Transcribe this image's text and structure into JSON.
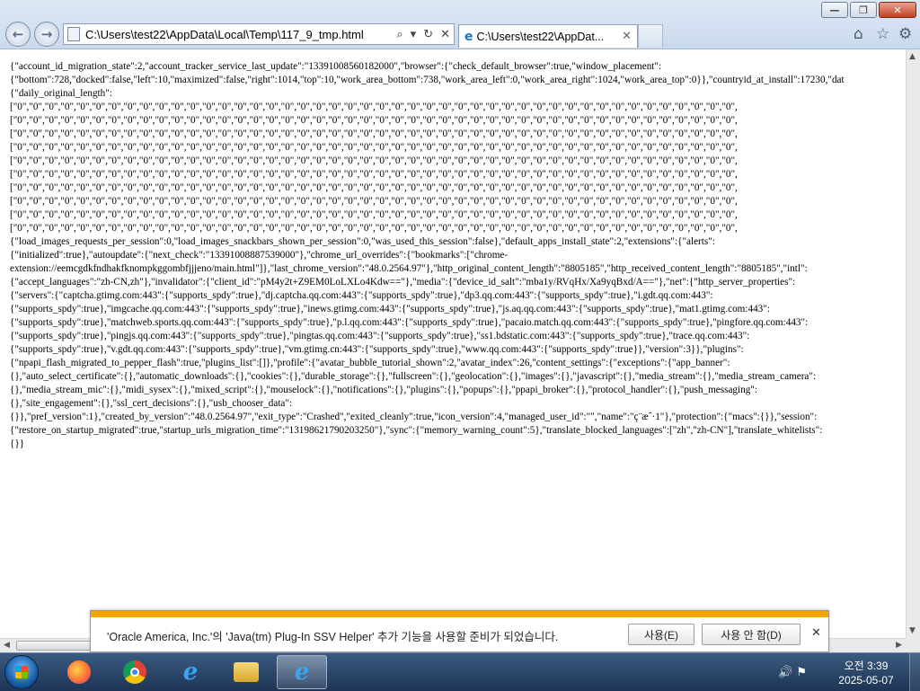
{
  "window": {
    "caption_minimize": "—",
    "caption_restore": "❐",
    "caption_close": "✕"
  },
  "nav": {
    "address": "C:\\Users\\test22\\AppData\\Local\\Temp\\117_9_tmp.html",
    "tab_title": "C:\\Users\\test22\\AppDat...",
    "back_glyph": "←",
    "forward_glyph": "→",
    "search_glyph": "⌕",
    "dropdown_glyph": "▾",
    "refresh_glyph": "↻",
    "stop_glyph": "✕",
    "home_glyph": "⌂",
    "favorites_glyph": "☆",
    "tools_glyph": "⚙",
    "ie_glyph": "e",
    "tab_close_glyph": "✕"
  },
  "document": {
    "lines": [
      "{\"account_id_migration_state\":2,\"account_tracker_service_last_update\":\"13391008560182000\",\"browser\":{\"check_default_browser\":true,\"window_placement\":",
      "{\"bottom\":728,\"docked\":false,\"left\":10,\"maximized\":false,\"right\":1014,\"top\":10,\"work_area_bottom\":738,\"work_area_left\":0,\"work_area_right\":1024,\"work_area_top\":0}},\"countryid_at_install\":17230,\"dat",
      "{\"daily_original_length\":",
      "[\"0\",\"0\",\"0\",\"0\",\"0\",\"0\",\"0\",\"0\",\"0\",\"0\",\"0\",\"0\",\"0\",\"0\",\"0\",\"0\",\"0\",\"0\",\"0\",\"0\",\"0\",\"0\",\"0\",\"0\",\"0\",\"0\",\"0\",\"0\",\"0\",\"0\",\"0\",\"0\",\"0\",\"0\",\"0\",\"0\",\"0\",\"0\",\"0\",\"0\",\"0\",\"0\",\"0\",\"0\",\"0\",\"0\",",
      "[\"0\",\"0\",\"0\",\"0\",\"0\",\"0\",\"0\",\"0\",\"0\",\"0\",\"0\",\"0\",\"0\",\"0\",\"0\",\"0\",\"0\",\"0\",\"0\",\"0\",\"0\",\"0\",\"0\",\"0\",\"0\",\"0\",\"0\",\"0\",\"0\",\"0\",\"0\",\"0\",\"0\",\"0\",\"0\",\"0\",\"0\",\"0\",\"0\",\"0\",\"0\",\"0\",\"0\",\"0\",\"0\",\"0\",",
      "[\"0\",\"0\",\"0\",\"0\",\"0\",\"0\",\"0\",\"0\",\"0\",\"0\",\"0\",\"0\",\"0\",\"0\",\"0\",\"0\",\"0\",\"0\",\"0\",\"0\",\"0\",\"0\",\"0\",\"0\",\"0\",\"0\",\"0\",\"0\",\"0\",\"0\",\"0\",\"0\",\"0\",\"0\",\"0\",\"0\",\"0\",\"0\",\"0\",\"0\",\"0\",\"0\",\"0\",\"0\",\"0\",\"0\",",
      "[\"0\",\"0\",\"0\",\"0\",\"0\",\"0\",\"0\",\"0\",\"0\",\"0\",\"0\",\"0\",\"0\",\"0\",\"0\",\"0\",\"0\",\"0\",\"0\",\"0\",\"0\",\"0\",\"0\",\"0\",\"0\",\"0\",\"0\",\"0\",\"0\",\"0\",\"0\",\"0\",\"0\",\"0\",\"0\",\"0\",\"0\",\"0\",\"0\",\"0\",\"0\",\"0\",\"0\",\"0\",\"0\",\"0\",",
      "[\"0\",\"0\",\"0\",\"0\",\"0\",\"0\",\"0\",\"0\",\"0\",\"0\",\"0\",\"0\",\"0\",\"0\",\"0\",\"0\",\"0\",\"0\",\"0\",\"0\",\"0\",\"0\",\"0\",\"0\",\"0\",\"0\",\"0\",\"0\",\"0\",\"0\",\"0\",\"0\",\"0\",\"0\",\"0\",\"0\",\"0\",\"0\",\"0\",\"0\",\"0\",\"0\",\"0\",\"0\",\"0\",\"0\",",
      "[\"0\",\"0\",\"0\",\"0\",\"0\",\"0\",\"0\",\"0\",\"0\",\"0\",\"0\",\"0\",\"0\",\"0\",\"0\",\"0\",\"0\",\"0\",\"0\",\"0\",\"0\",\"0\",\"0\",\"0\",\"0\",\"0\",\"0\",\"0\",\"0\",\"0\",\"0\",\"0\",\"0\",\"0\",\"0\",\"0\",\"0\",\"0\",\"0\",\"0\",\"0\",\"0\",\"0\",\"0\",\"0\",\"0\",",
      "[\"0\",\"0\",\"0\",\"0\",\"0\",\"0\",\"0\",\"0\",\"0\",\"0\",\"0\",\"0\",\"0\",\"0\",\"0\",\"0\",\"0\",\"0\",\"0\",\"0\",\"0\",\"0\",\"0\",\"0\",\"0\",\"0\",\"0\",\"0\",\"0\",\"0\",\"0\",\"0\",\"0\",\"0\",\"0\",\"0\",\"0\",\"0\",\"0\",\"0\",\"0\",\"0\",\"0\",\"0\",\"0\",\"0\",",
      "[\"0\",\"0\",\"0\",\"0\",\"0\",\"0\",\"0\",\"0\",\"0\",\"0\",\"0\",\"0\",\"0\",\"0\",\"0\",\"0\",\"0\",\"0\",\"0\",\"0\",\"0\",\"0\",\"0\",\"0\",\"0\",\"0\",\"0\",\"0\",\"0\",\"0\",\"0\",\"0\",\"0\",\"0\",\"0\",\"0\",\"0\",\"0\",\"0\",\"0\",\"0\",\"0\",\"0\",\"0\",\"0\",\"0\",",
      "[\"0\",\"0\",\"0\",\"0\",\"0\",\"0\",\"0\",\"0\",\"0\",\"0\",\"0\",\"0\",\"0\",\"0\",\"0\",\"0\",\"0\",\"0\",\"0\",\"0\",\"0\",\"0\",\"0\",\"0\",\"0\",\"0\",\"0\",\"0\",\"0\",\"0\",\"0\",\"0\",\"0\",\"0\",\"0\",\"0\",\"0\",\"0\",\"0\",\"0\",\"0\",\"0\",\"0\",\"0\",\"0\",\"0\",",
      "[\"0\",\"0\",\"0\",\"0\",\"0\",\"0\",\"0\",\"0\",\"0\",\"0\",\"0\",\"0\",\"0\",\"0\",\"0\",\"0\",\"0\",\"0\",\"0\",\"0\",\"0\",\"0\",\"0\",\"0\",\"0\",\"0\",\"0\",\"0\",\"0\",\"0\",\"0\",\"0\",\"0\",\"0\",\"0\",\"0\",\"0\",\"0\",\"0\",\"0\",\"0\",\"0\",\"0\",\"0\",\"0\",\"0\",",
      "{\"load_images_requests_per_session\":0,\"load_images_snackbars_shown_per_session\":0,\"was_used_this_session\":false},\"default_apps_install_state\":2,\"extensions\":{\"alerts\":",
      "{\"initialized\":true},\"autoupdate\":{\"next_check\":\"13391008887539000\"},\"chrome_url_overrides\":{\"bookmarks\":[\"chrome-",
      "extension://eemcgdkfndhakfknompkggombfjjjeno/main.html\"]},\"last_chrome_version\":\"48.0.2564.97\"},\"http_original_content_length\":\"8805185\",\"http_received_content_length\":\"8805185\",\"intl\":",
      "{\"accept_languages\":\"zh-CN,zh\"},\"invalidator\":{\"client_id\":\"pM4y2t+Z9EM0LoLXLo4Kdw==\"},\"media\":{\"device_id_salt\":\"mba1y/RVqHx/Xa9yqBxd/A==\"},\"net\":{\"http_server_properties\":",
      "{\"servers\":{\"captcha.gtimg.com:443\":{\"supports_spdy\":true},\"dj.captcha.qq.com:443\":{\"supports_spdy\":true},\"dp3.qq.com:443\":{\"supports_spdy\":true},\"i.gdt.qq.com:443\":",
      "{\"supports_spdy\":true},\"imgcache.qq.com:443\":{\"supports_spdy\":true},\"inews.gtimg.com:443\":{\"supports_spdy\":true},\"js.aq.qq.com:443\":{\"supports_spdy\":true},\"mat1.gtimg.com:443\":",
      "{\"supports_spdy\":true},\"matchweb.sports.qq.com:443\":{\"supports_spdy\":true},\"p.l.qq.com:443\":{\"supports_spdy\":true},\"pacaio.match.qq.com:443\":{\"supports_spdy\":true},\"pingfore.qq.com:443\":",
      "{\"supports_spdy\":true},\"pingjs.qq.com:443\":{\"supports_spdy\":true},\"pingtas.qq.com:443\":{\"supports_spdy\":true},\"ss1.bdstatic.com:443\":{\"supports_spdy\":true},\"trace.qq.com:443\":",
      "{\"supports_spdy\":true},\"v.gdt.qq.com:443\":{\"supports_spdy\":true},\"vm.gtimg.cn:443\":{\"supports_spdy\":true},\"www.qq.com:443\":{\"supports_spdy\":true}},\"version\":3}},\"plugins\":",
      "{\"npapi_flash_migrated_to_pepper_flash\":true,\"plugins_list\":[]},\"profile\":{\"avatar_bubble_tutorial_shown\":2,\"avatar_index\":26,\"content_settings\":{\"exceptions\":{\"app_banner\":",
      "{},\"auto_select_certificate\":{},\"automatic_downloads\":{},\"cookies\":{},\"durable_storage\":{},\"fullscreen\":{},\"geolocation\":{},\"images\":{},\"javascript\":{},\"media_stream\":{},\"media_stream_camera\":",
      "{},\"media_stream_mic\":{},\"midi_sysex\":{},\"mixed_script\":{},\"mouselock\":{},\"notifications\":{},\"plugins\":{},\"popups\":{},\"ppapi_broker\":{},\"protocol_handler\":{},\"push_messaging\":",
      "{},\"site_engagement\":{},\"ssl_cert_decisions\":{},\"usb_chooser_data\":",
      "{}},\"pref_version\":1},\"created_by_version\":\"48.0.2564.97\",\"exit_type\":\"Crashed\",\"exited_cleanly\":true,\"icon_version\":4,\"managed_user_id\":\"\",\"name\":\"ç¨æˆ·1\"},\"protection\":{\"macs\":{}},\"session\":",
      "{\"restore_on_startup_migrated\":true,\"startup_urls_migration_time\":\"13198621790203250\"},\"sync\":{\"memory_warning_count\":5},\"translate_blocked_languages\":[\"zh\",\"zh-CN\"],\"translate_whitelists\":",
      "{}}"
    ]
  },
  "notification": {
    "message": "'Oracle America, Inc.'의 'Java(tm) Plug-In SSV Helper' 추가 기능을 사용할 준비가 되었습니다.",
    "allow_label": "사용(E)",
    "deny_label": "사용 안 함(D)",
    "close_glyph": "✕",
    "accent_color": "#f5a300"
  },
  "taskbar": {
    "clock_time": "오전 3:39",
    "clock_date": "2025-05-07",
    "tray_glyphs": "🔊 ⚑"
  },
  "scrollbar": {
    "up_glyph": "▲",
    "down_glyph": "▼",
    "left_glyph": "◀",
    "right_glyph": "▶"
  }
}
